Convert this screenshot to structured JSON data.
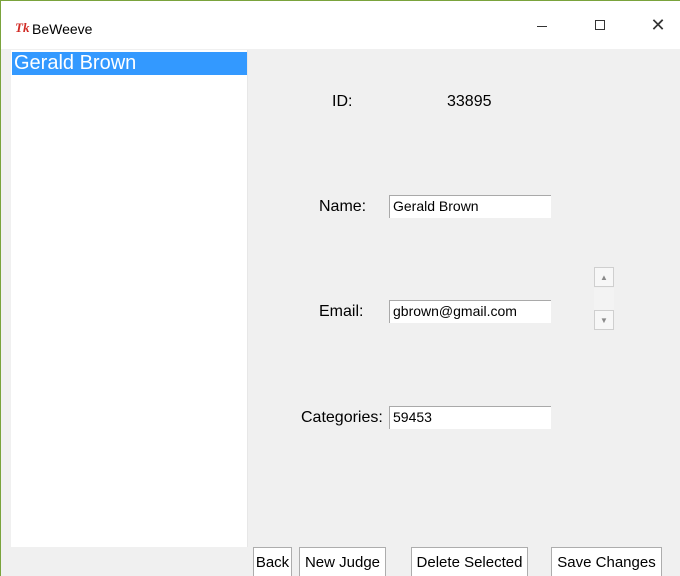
{
  "window": {
    "title": "BeWeeve",
    "icon": "Tk"
  },
  "controls": {
    "minimize": "—",
    "maximize": "□",
    "close": "✕"
  },
  "list": {
    "items": [
      "Gerald Brown"
    ]
  },
  "form": {
    "id_label": "ID:",
    "id_value": "33895",
    "name_label": "Name:",
    "name_value": "Gerald Brown",
    "email_label": "Email:",
    "email_value": "gbrown@gmail.com",
    "categories_label": "Categories:",
    "categories_value": "59453"
  },
  "scroll": {
    "up": "▲",
    "down": "▼"
  },
  "buttons": {
    "back": "Back",
    "new_judge": "New Judge",
    "delete_selected": "Delete Selected",
    "save_changes": "Save Changes"
  }
}
